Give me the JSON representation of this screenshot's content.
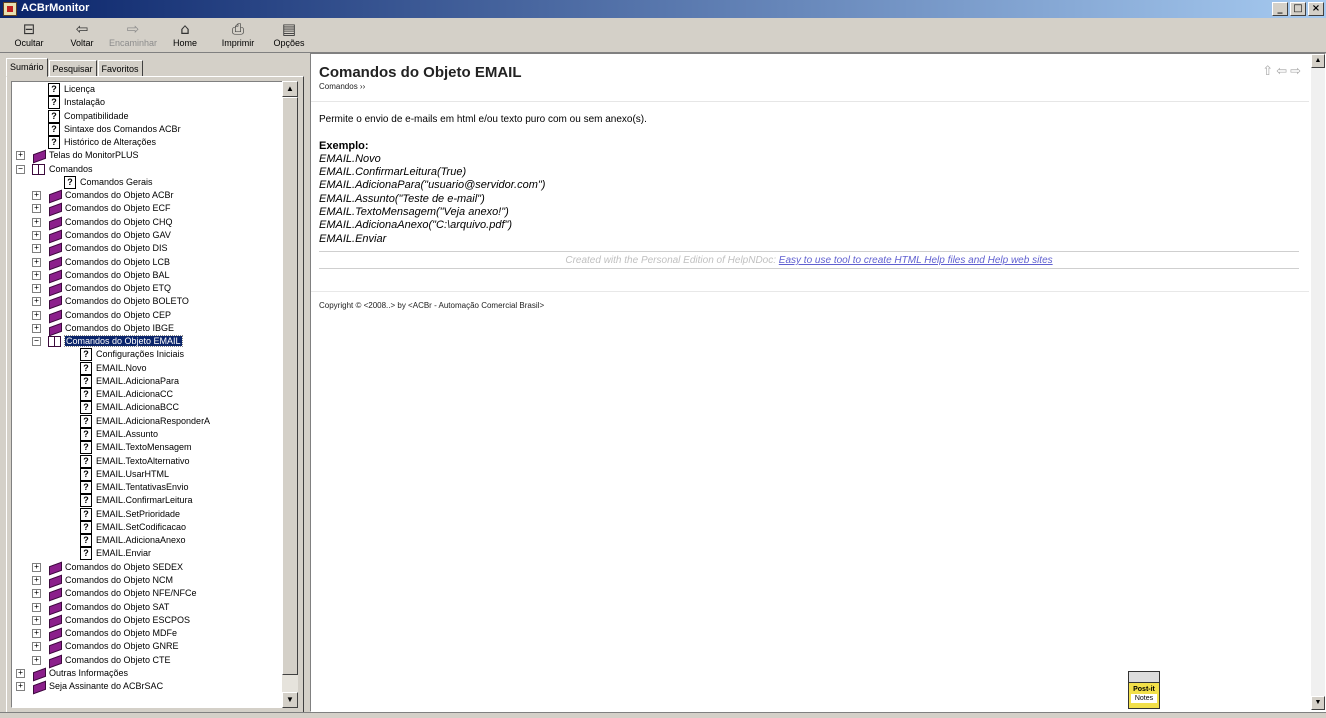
{
  "window": {
    "title": "ACBrMonitor",
    "minimize": "_",
    "maximize": "□",
    "close": "×"
  },
  "toolbar": {
    "buttons": [
      {
        "label": "Ocultar",
        "icon": "⊟"
      },
      {
        "label": "Voltar",
        "icon": "⇦"
      },
      {
        "label": "Encaminhar",
        "icon": "⇨"
      },
      {
        "label": "Home",
        "icon": "⌂"
      },
      {
        "label": "Imprimir",
        "icon": "⎙"
      },
      {
        "label": "Opções",
        "icon": "▤"
      }
    ]
  },
  "tabs": [
    "Sumário",
    "Pesquisar",
    "Favoritos"
  ],
  "tree": {
    "items": [
      {
        "label": "Licença",
        "type": "help",
        "level": 1
      },
      {
        "label": "Instalação",
        "type": "help",
        "level": 1
      },
      {
        "label": "Compatibilidade",
        "type": "help",
        "level": 1
      },
      {
        "label": "Sintaxe dos Comandos ACBr",
        "type": "help",
        "level": 1
      },
      {
        "label": "Histórico de Alterações",
        "type": "help",
        "level": 1
      },
      {
        "label": "Telas do MonitorPLUS",
        "type": "book",
        "level": 0,
        "expander": "+"
      },
      {
        "label": "Comandos",
        "type": "openbook",
        "level": 0,
        "expander": "−"
      },
      {
        "label": "Comandos Gerais",
        "type": "help",
        "level": 2
      },
      {
        "label": "Comandos do Objeto ACBr",
        "type": "book",
        "level": 1,
        "expander": "+"
      },
      {
        "label": "Comandos do Objeto ECF",
        "type": "book",
        "level": 1,
        "expander": "+"
      },
      {
        "label": "Comandos do Objeto CHQ",
        "type": "book",
        "level": 1,
        "expander": "+"
      },
      {
        "label": "Comandos do Objeto GAV",
        "type": "book",
        "level": 1,
        "expander": "+"
      },
      {
        "label": "Comandos do Objeto DIS",
        "type": "book",
        "level": 1,
        "expander": "+"
      },
      {
        "label": "Comandos do Objeto LCB",
        "type": "book",
        "level": 1,
        "expander": "+"
      },
      {
        "label": "Comandos do Objeto BAL",
        "type": "book",
        "level": 1,
        "expander": "+"
      },
      {
        "label": "Comandos do Objeto ETQ",
        "type": "book",
        "level": 1,
        "expander": "+"
      },
      {
        "label": "Comandos do Objeto BOLETO",
        "type": "book",
        "level": 1,
        "expander": "+"
      },
      {
        "label": "Comandos do Objeto CEP",
        "type": "book",
        "level": 1,
        "expander": "+"
      },
      {
        "label": "Comandos do Objeto IBGE",
        "type": "book",
        "level": 1,
        "expander": "+"
      },
      {
        "label": "Comandos do Objeto EMAIL",
        "type": "openbook",
        "level": 1,
        "expander": "−",
        "selected": true
      },
      {
        "label": "Configurações Iniciais",
        "type": "help",
        "level": 3
      },
      {
        "label": "EMAIL.Novo",
        "type": "help",
        "level": 3
      },
      {
        "label": "EMAIL.AdicionaPara",
        "type": "help",
        "level": 3
      },
      {
        "label": "EMAIL.AdicionaCC",
        "type": "help",
        "level": 3
      },
      {
        "label": "EMAIL.AdicionaBCC",
        "type": "help",
        "level": 3
      },
      {
        "label": "EMAIL.AdicionaResponderA",
        "type": "help",
        "level": 3
      },
      {
        "label": "EMAIL.Assunto",
        "type": "help",
        "level": 3
      },
      {
        "label": "EMAIL.TextoMensagem",
        "type": "help",
        "level": 3
      },
      {
        "label": "EMAIL.TextoAlternativo",
        "type": "help",
        "level": 3
      },
      {
        "label": "EMAIL.UsarHTML",
        "type": "help",
        "level": 3
      },
      {
        "label": "EMAIL.TentativasEnvio",
        "type": "help",
        "level": 3
      },
      {
        "label": "EMAIL.ConfirmarLeitura",
        "type": "help",
        "level": 3
      },
      {
        "label": "EMAIL.SetPrioridade",
        "type": "help",
        "level": 3
      },
      {
        "label": "EMAIL.SetCodificacao",
        "type": "help",
        "level": 3
      },
      {
        "label": "EMAIL.AdicionaAnexo",
        "type": "help",
        "level": 3
      },
      {
        "label": "EMAIL.Enviar",
        "type": "help",
        "level": 3
      },
      {
        "label": "Comandos do Objeto SEDEX",
        "type": "book",
        "level": 1,
        "expander": "+"
      },
      {
        "label": "Comandos do Objeto NCM",
        "type": "book",
        "level": 1,
        "expander": "+"
      },
      {
        "label": "Comandos do Objeto NFE/NFCe",
        "type": "book",
        "level": 1,
        "expander": "+"
      },
      {
        "label": "Comandos do Objeto SAT",
        "type": "book",
        "level": 1,
        "expander": "+"
      },
      {
        "label": "Comandos do Objeto ESCPOS",
        "type": "book",
        "level": 1,
        "expander": "+"
      },
      {
        "label": "Comandos do Objeto MDFe",
        "type": "book",
        "level": 1,
        "expander": "+"
      },
      {
        "label": "Comandos do Objeto GNRE",
        "type": "book",
        "level": 1,
        "expander": "+"
      },
      {
        "label": "Comandos do Objeto CTE",
        "type": "book",
        "level": 1,
        "expander": "+"
      },
      {
        "label": "Outras Informações",
        "type": "book",
        "level": 0,
        "expander": "+"
      },
      {
        "label": "Seja Assinante do ACBrSAC",
        "type": "book",
        "level": 0,
        "expander": "+"
      }
    ]
  },
  "content": {
    "title": "Comandos do Objeto EMAIL",
    "breadcrumb": "Comandos ››",
    "nav": {
      "up": "⇧",
      "back": "⇦",
      "forward": "⇨"
    },
    "intro": "Permite o envio de e-mails em html e/ou texto puro com ou sem anexo(s).",
    "example_title": "Exemplo:",
    "example_lines": [
      "EMAIL.Novo",
      "EMAIL.ConfirmarLeitura(True)",
      "EMAIL.AdicionaPara(\"usuario@servidor.com\")",
      "EMAIL.Assunto(\"Teste de e-mail\")",
      "EMAIL.TextoMensagem(\"Veja anexo!\")",
      "EMAIL.AdicionaAnexo(\"C:\\arquivo.pdf\")",
      "EMAIL.Enviar"
    ],
    "credit_text": "Created with the Personal Edition of HelpNDoc: ",
    "credit_link": "Easy to use tool to create HTML Help files and Help web sites",
    "copyright": "Copyright © <2008..> by <ACBr - Automação Comercial Brasil>"
  },
  "postit": {
    "label1": "Post-it",
    "label2": "Notes"
  },
  "colors": {
    "selection": "#0a246a",
    "titlebar": "#0a246a",
    "book": "#8b1f8b"
  }
}
